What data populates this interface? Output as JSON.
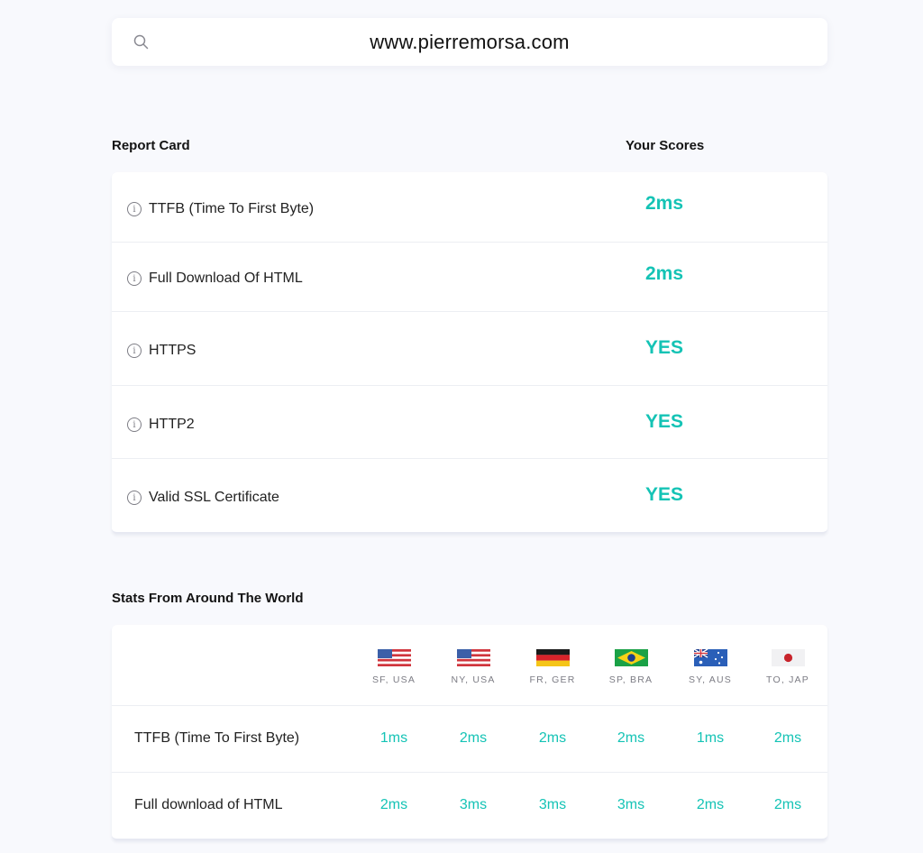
{
  "search": {
    "query": "www.pierremorsa.com",
    "icon": "search-icon"
  },
  "report_card": {
    "title": "Report Card",
    "scores_header": "Your Scores",
    "rows": [
      {
        "label": "TTFB (Time To First Byte)",
        "value": "2ms"
      },
      {
        "label": "Full Download Of HTML",
        "value": "2ms"
      },
      {
        "label": "HTTPS",
        "value": "YES"
      },
      {
        "label": "HTTP2",
        "value": "YES"
      },
      {
        "label": "Valid SSL Certificate",
        "value": "YES"
      }
    ]
  },
  "world_stats": {
    "title": "Stats From Around The World",
    "locations": [
      {
        "label": "SF, USA",
        "flag": "usa-flag-icon"
      },
      {
        "label": "NY, USA",
        "flag": "usa-flag-icon"
      },
      {
        "label": "FR, GER",
        "flag": "germany-flag-icon"
      },
      {
        "label": "SP, BRA",
        "flag": "brazil-flag-icon"
      },
      {
        "label": "SY, AUS",
        "flag": "australia-flag-icon"
      },
      {
        "label": "TO, JAP",
        "flag": "japan-flag-icon"
      }
    ],
    "metrics": [
      {
        "label": "TTFB (Time To First Byte)",
        "values": [
          "1ms",
          "2ms",
          "2ms",
          "2ms",
          "1ms",
          "2ms"
        ]
      },
      {
        "label": "Full download of HTML",
        "values": [
          "2ms",
          "3ms",
          "3ms",
          "3ms",
          "2ms",
          "2ms"
        ]
      }
    ]
  },
  "colors": {
    "accent": "#14c3b5",
    "background": "#f8f9fd"
  }
}
